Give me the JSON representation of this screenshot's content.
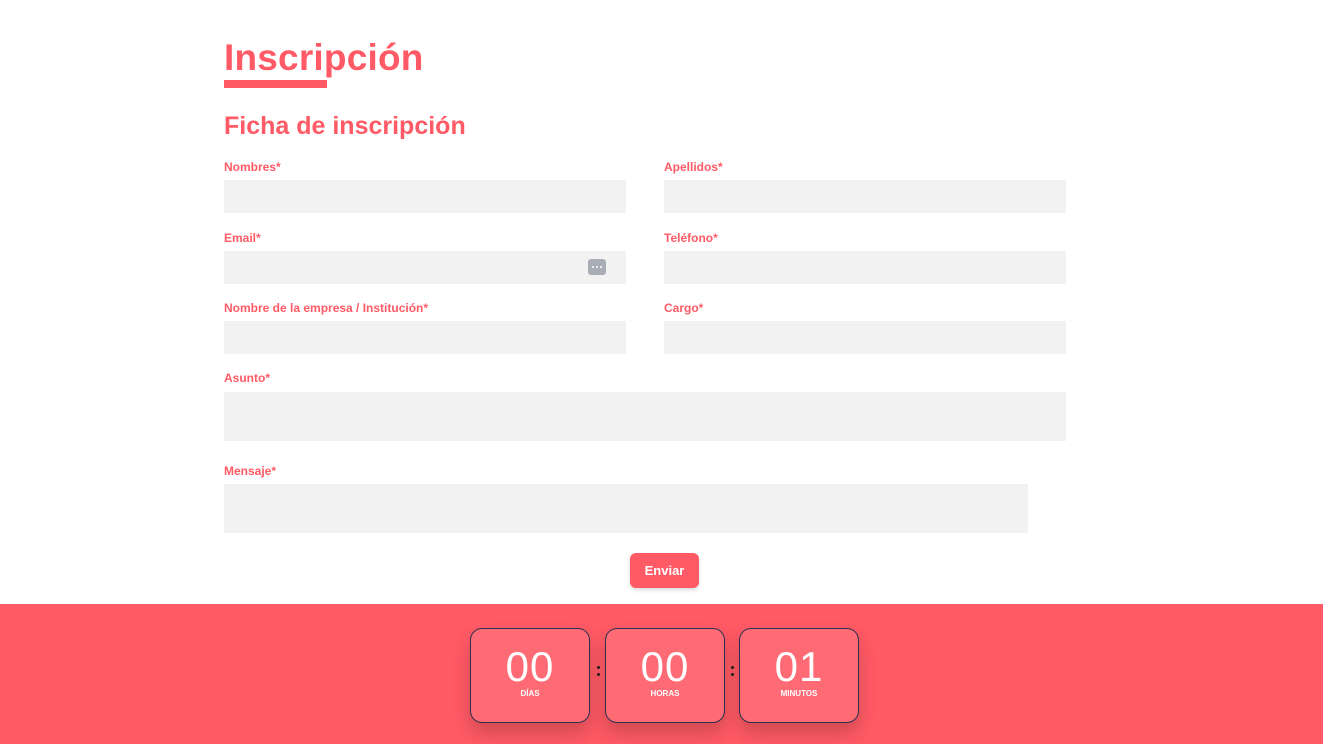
{
  "page": {
    "title": "Inscripción",
    "subtitle": "Ficha de inscripción"
  },
  "form": {
    "fields": {
      "nombres": {
        "label": "Nombres*",
        "value": ""
      },
      "apellidos": {
        "label": "Apellidos*",
        "value": ""
      },
      "email": {
        "label": "Email*",
        "value": "",
        "icon": "password-manager-icon"
      },
      "telefono": {
        "label": "Teléfono*",
        "value": ""
      },
      "empresa": {
        "label": "Nombre de la empresa / Institución*",
        "value": ""
      },
      "cargo": {
        "label": "Cargo*",
        "value": ""
      },
      "asunto": {
        "label": "Asunto*",
        "value": ""
      },
      "mensaje": {
        "label": "Mensaje*",
        "value": ""
      }
    },
    "submit_label": "Enviar"
  },
  "countdown": {
    "days": {
      "value": "00",
      "label": "DÍAS"
    },
    "hours": {
      "value": "00",
      "label": "HORAS"
    },
    "minutes": {
      "value": "01",
      "label": "MINUTOS"
    }
  },
  "colors": {
    "accent": "#ff5a65",
    "field_bg": "#f2f2f2",
    "countdown_box": "#ff6b75"
  }
}
